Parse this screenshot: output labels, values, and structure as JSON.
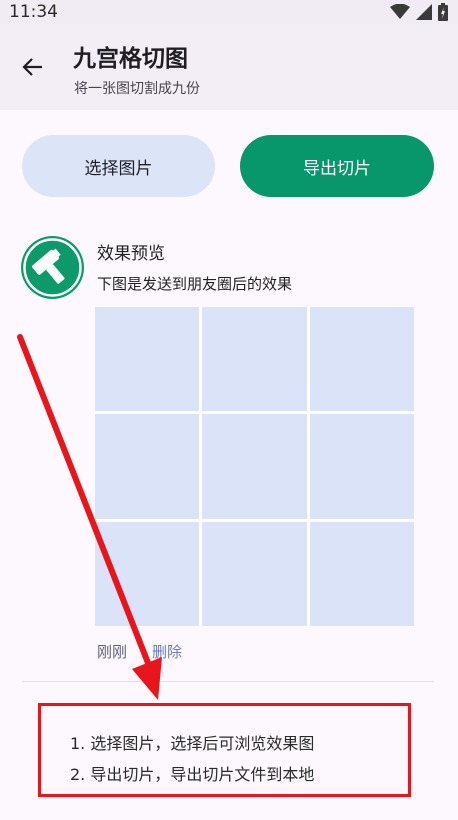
{
  "status_bar": {
    "time": "11:34",
    "icons": [
      "wifi-icon",
      "signal-icon",
      "battery-icon"
    ]
  },
  "appbar": {
    "title": "九宫格切图",
    "subtitle": "将一张图切割成九份",
    "back_icon": "arrow-back-icon"
  },
  "actions": {
    "select_label": "选择图片",
    "export_label": "导出切片"
  },
  "card": {
    "avatar_icon": "hammer-icon",
    "title": "效果预览",
    "description": "下图是发送到朋友圈后的效果",
    "tiles": 9,
    "time": "刚刚",
    "delete_label": "删除"
  },
  "instructions": [
    "1. 选择图片，选择后可浏览效果图",
    "2. 导出切片，导出切片文件到本地"
  ],
  "colors": {
    "primary": "#08976a",
    "secondary_button": "#dce4f7",
    "tile": "#dae3f8",
    "annotation": "#e8151b"
  }
}
